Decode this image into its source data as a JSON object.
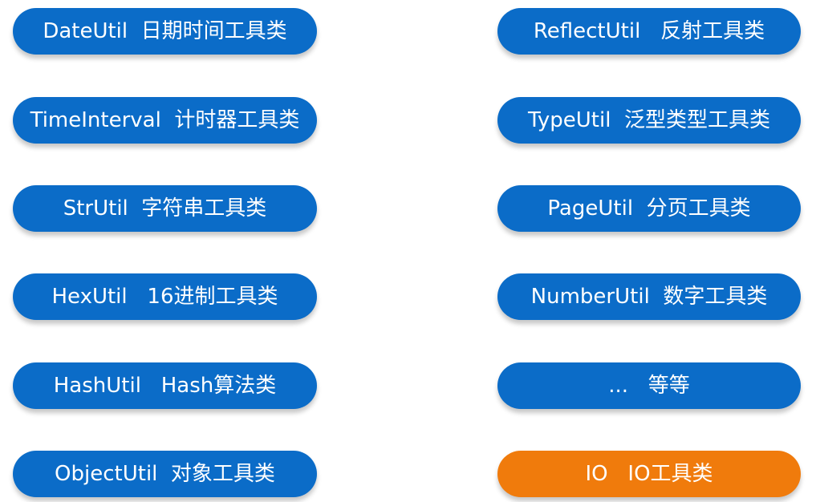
{
  "colors": {
    "pill_blue": "#0b6cc8",
    "pill_orange": "#f07b0c",
    "text": "#ffffff"
  },
  "left_column": [
    "DateUtil  日期时间工具类",
    "TimeInterval  计时器工具类",
    "StrUtil  字符串工具类",
    "HexUtil   16进制工具类",
    "HashUtil   Hash算法类",
    "ObjectUtil  对象工具类"
  ],
  "right_column": [
    "ReflectUtil   反射工具类",
    "TypeUtil  泛型类型工具类",
    "PageUtil  分页工具类",
    "NumberUtil  数字工具类",
    "...   等等",
    "IO   IO工具类"
  ]
}
